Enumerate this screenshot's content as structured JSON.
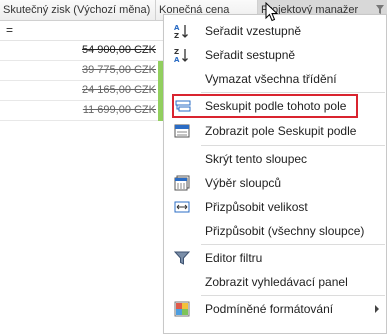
{
  "grid": {
    "columns": [
      "Skutečný zisk (Výchozí měna)",
      "Konečná cena",
      "Projektový manažer"
    ],
    "filter_operator": "=",
    "rows": [
      {
        "value": "54 900,00 CZK"
      },
      {
        "value": "39 775,00 CZK"
      },
      {
        "value": "24 165,00 CZK"
      },
      {
        "value": "11 699,00 CZK"
      }
    ]
  },
  "menu": {
    "items": {
      "sort_asc": "Seřadit vzestupně",
      "sort_desc": "Seřadit sestupně",
      "clear_sort": "Vymazat všechna třídění",
      "group_by": "Seskupit podle tohoto pole",
      "show_group_panel": "Zobrazit pole Seskupit podle",
      "hide_column": "Skrýt tento sloupec",
      "column_chooser": "Výběr sloupců",
      "best_fit": "Přizpůsobit velikost",
      "best_fit_all": "Přizpůsobit (všechny sloupce)",
      "filter_editor": "Editor filtru",
      "show_find_panel": "Zobrazit vyhledávací panel",
      "conditional_format": "Podmíněné formátování"
    }
  },
  "colors": {
    "highlight_border": "#d9242f",
    "green_marker": "#92cf5f",
    "accent_blue": "#2b6cc4"
  }
}
